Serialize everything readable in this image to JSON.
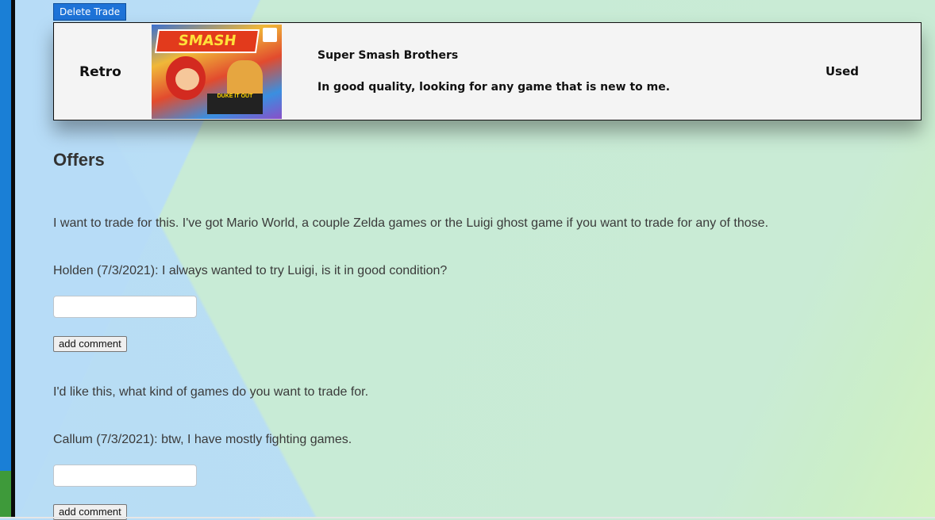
{
  "trade": {
    "delete_label": "Delete Trade",
    "category": "Retro",
    "title": "Super Smash Brothers",
    "description": "In good quality, looking for any game that is new to me.",
    "condition": "Used",
    "cover_logo": "SMASH",
    "cover_banner": "DUKE IT OUT"
  },
  "offers": {
    "heading": "Offers",
    "items": [
      {
        "message": "I want to trade for this. I've got Mario World, a couple Zelda games or the Luigi ghost game if you want to trade for any of those.",
        "comments": [
          "Holden (7/3/2021): I always wanted to try Luigi, is it in good condition?"
        ],
        "input_value": "",
        "button_label": "add comment"
      },
      {
        "message": "I'd like this, what kind of games do you want to trade for.",
        "comments": [
          "Callum (7/3/2021): btw, I have mostly fighting games."
        ],
        "input_value": "",
        "button_label": "add comment"
      }
    ]
  },
  "colors": {
    "accent_blue": "#1e73d8",
    "bg_blue": "#b7dcf7",
    "bg_green": "#c9ebd5"
  }
}
